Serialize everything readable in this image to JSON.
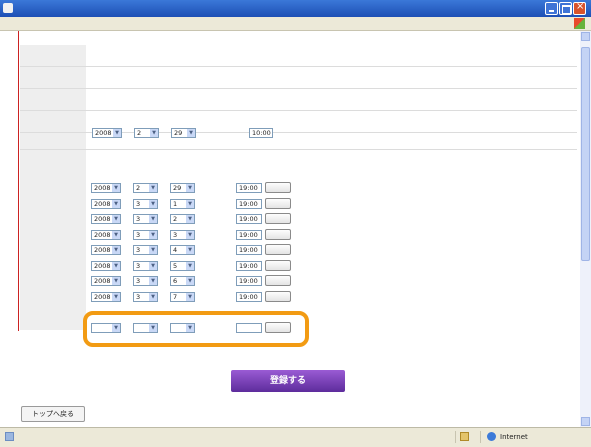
{
  "window": {
    "icon": "ie-icon"
  },
  "date_rows": [
    {
      "year": "2008",
      "month": "2",
      "day": "29",
      "time": "19:00"
    },
    {
      "year": "2008",
      "month": "3",
      "day": "1",
      "time": "19:00"
    },
    {
      "year": "2008",
      "month": "3",
      "day": "2",
      "time": "19:00"
    },
    {
      "year": "2008",
      "month": "3",
      "day": "3",
      "time": "19:00"
    },
    {
      "year": "2008",
      "month": "3",
      "day": "4",
      "time": "19:00"
    },
    {
      "year": "2008",
      "month": "3",
      "day": "5",
      "time": "19:00"
    },
    {
      "year": "2008",
      "month": "3",
      "day": "6",
      "time": "19:00"
    },
    {
      "year": "2008",
      "month": "3",
      "day": "7",
      "time": "19:00"
    },
    {
      "year": "",
      "month": "",
      "day": "",
      "time": ""
    }
  ],
  "sale_start": {
    "year": "2008",
    "month": "2",
    "day": "29",
    "time": "10:00"
  },
  "register_button": "登録する",
  "top_link": "トップへ戻る",
  "status": {
    "zone": "Internet",
    "page_icon": "page-done-icon",
    "lock_icon": "security-icon"
  },
  "colors": {
    "highlight": "#f29b13",
    "register": "#7a44b8",
    "required_line": "#cc2222"
  }
}
